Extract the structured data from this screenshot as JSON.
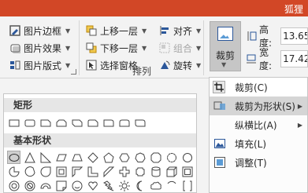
{
  "titlebar": {
    "user_name": "狐狸"
  },
  "ribbon": {
    "picture_styles": {
      "border_label": "图片边框",
      "effects_label": "图片效果",
      "layout_label": "图片版式"
    },
    "arrange": {
      "bring_forward_label": "上移一层",
      "send_backward_label": "下移一层",
      "selection_pane_label": "选择窗格",
      "align_label": "对齐",
      "group_label": "组合",
      "rotate_label": "旋转",
      "group_title": "排列"
    },
    "size": {
      "crop_label": "裁剪",
      "height_label": "高度:",
      "height_value": "13.65",
      "width_label": "宽度:",
      "width_value": "17.42"
    }
  },
  "gallery": {
    "section_rect": "矩形",
    "section_basic": "基本形状"
  },
  "context_menu": {
    "items": [
      {
        "label": "裁剪(C)",
        "icon": "crop-icon"
      },
      {
        "label": "裁剪为形状(S)",
        "icon": "crop-to-shape-icon"
      },
      {
        "label": "纵横比(A)",
        "icon": ""
      },
      {
        "label": "填充(L)",
        "icon": "fill-icon"
      },
      {
        "label": "调整(T)",
        "icon": "fit-icon"
      }
    ]
  },
  "colors": {
    "accent": "#d24726",
    "icon_blue": "#2b579a"
  }
}
